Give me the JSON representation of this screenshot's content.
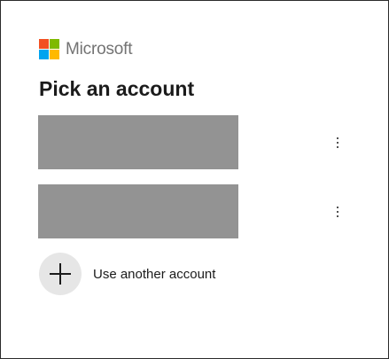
{
  "brand": {
    "name": "Microsoft",
    "logo_colors": [
      "#f25022",
      "#7fba00",
      "#00a4ef",
      "#ffb900"
    ]
  },
  "title": "Pick an account",
  "accounts": [
    {
      "redacted": true,
      "more_icon": "more-vertical-icon"
    },
    {
      "redacted": true,
      "more_icon": "more-vertical-icon"
    }
  ],
  "use_another": {
    "label": "Use another account",
    "icon": "plus-icon"
  },
  "colors": {
    "redaction": "#939393",
    "icon_circle": "#e6e6e6",
    "text": "#1b1b1b",
    "brand_text": "#737373"
  }
}
